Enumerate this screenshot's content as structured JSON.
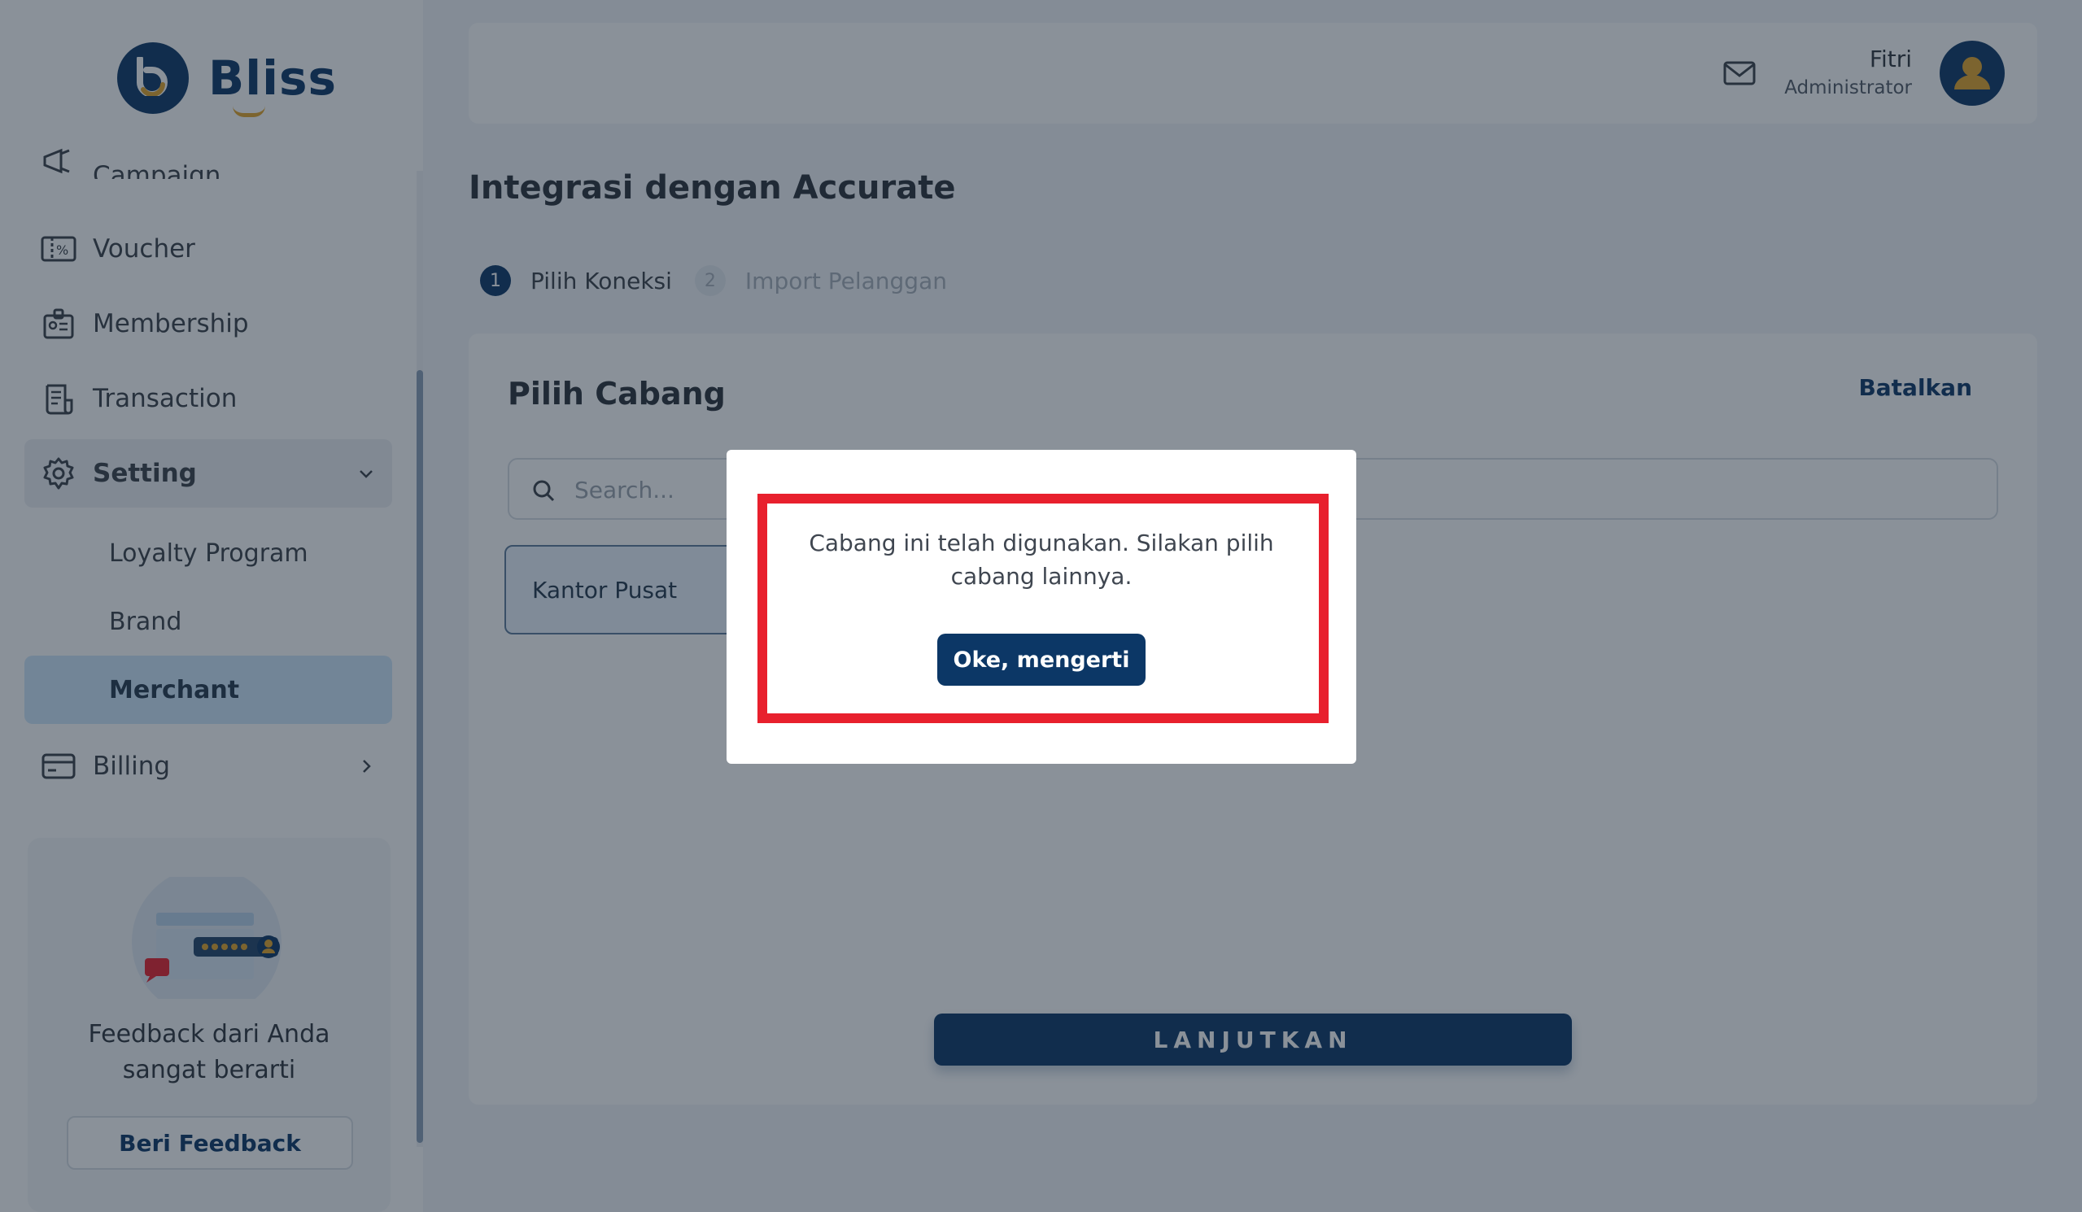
{
  "app": {
    "name": "Bliss"
  },
  "sidebar": {
    "items": [
      {
        "label": "Campaign",
        "icon": "megaphone-icon"
      },
      {
        "label": "Voucher",
        "icon": "voucher-icon"
      },
      {
        "label": "Membership",
        "icon": "membership-card-icon"
      },
      {
        "label": "Transaction",
        "icon": "receipt-icon"
      },
      {
        "label": "Setting",
        "icon": "gear-icon",
        "expanded": true
      }
    ],
    "sub_items": [
      {
        "label": "Loyalty Program"
      },
      {
        "label": "Brand"
      },
      {
        "label": "Merchant",
        "active": true
      }
    ],
    "billing": {
      "label": "Billing",
      "icon": "credit-card-icon"
    },
    "feedback": {
      "text_line1": "Feedback dari Anda",
      "text_line2": "sangat berarti",
      "button": "Beri Feedback"
    }
  },
  "header": {
    "user_name": "Fitri",
    "user_role": "Administrator"
  },
  "page": {
    "title": "Integrasi dengan Accurate",
    "steps": [
      {
        "num": "1",
        "label": "Pilih Koneksi",
        "active": true
      },
      {
        "num": "2",
        "label": "Import Pelanggan",
        "active": false
      }
    ]
  },
  "card": {
    "title": "Pilih Cabang",
    "cancel": "Batalkan",
    "search_placeholder": "Search...",
    "branch": "Kantor Pusat",
    "next": "LANJUTKAN"
  },
  "modal": {
    "message": "Cabang ini telah digunakan. Silakan pilih cabang lainnya.",
    "ok": "Oke, mengerti"
  },
  "colors": {
    "primary": "#0c3766",
    "accent": "#e2a52b",
    "highlight": "#e8202d",
    "active_bg": "#cfe6fb"
  }
}
